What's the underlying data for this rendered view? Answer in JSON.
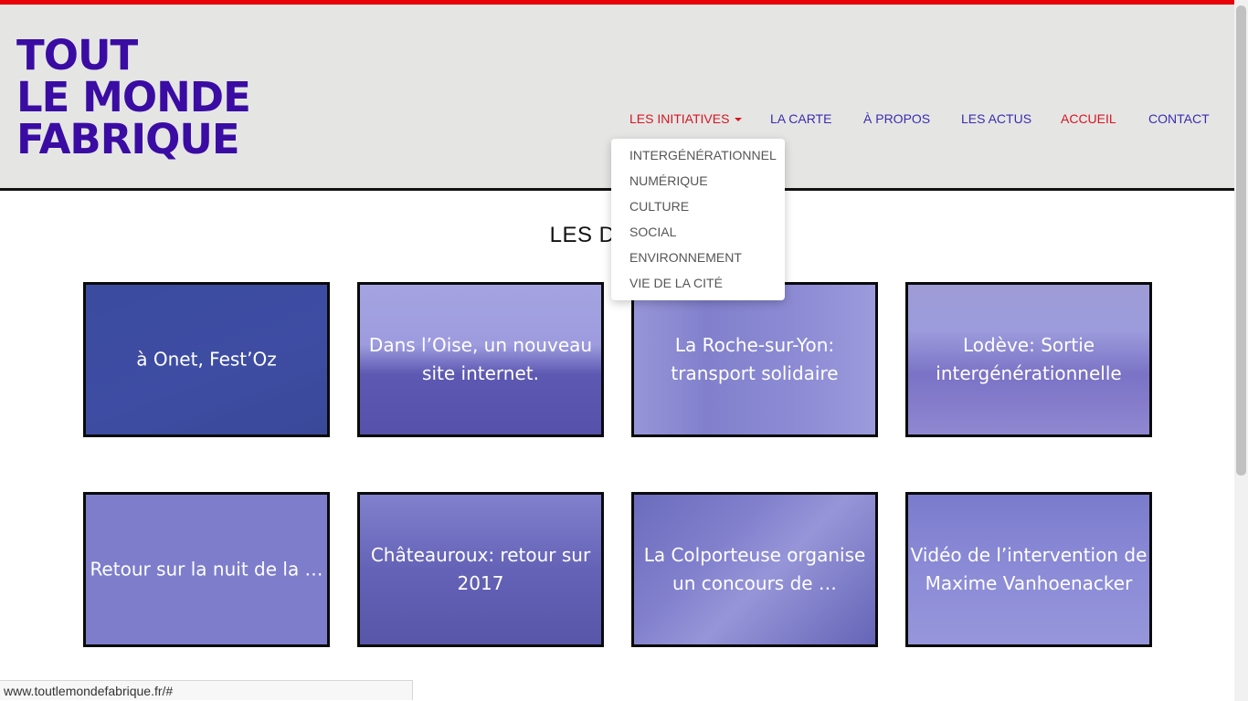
{
  "logo": {
    "line1": "TOUT",
    "line2": "LE MONDE",
    "line3": "FABRIQUE"
  },
  "nav": {
    "items": [
      {
        "label": "LES INITIATIVES"
      },
      {
        "label": "LA CARTE"
      },
      {
        "label": "À PROPOS"
      },
      {
        "label": "LES ACTUS"
      },
      {
        "label": "ACCUEIL"
      },
      {
        "label": "CONTACT"
      }
    ]
  },
  "dropdown": {
    "items": [
      "INTERGÉNÉRATIONNEL",
      "NUMÉRIQUE",
      "CULTURE",
      "SOCIAL",
      "ENVIRONNEMENT",
      "VIE DE LA CITÉ"
    ]
  },
  "section": {
    "title": "LES DERNIÈ"
  },
  "cards": [
    {
      "title": "à Onet, Fest’Oz"
    },
    {
      "title": "Dans l’Oise, un nouveau site internet."
    },
    {
      "title": "La Roche-sur-Yon: transport solidaire"
    },
    {
      "title": "Lodève: Sortie intergénérationnelle"
    },
    {
      "title": "Retour sur la nuit de la …"
    },
    {
      "title": "Châteauroux: retour sur 2017"
    },
    {
      "title": "La Colporteuse organise un concours de …"
    },
    {
      "title": "Vidéo de l’intervention de Maxime Vanhoenacker"
    }
  ],
  "status": {
    "url": "www.toutlemondefabrique.fr/#"
  },
  "colors": {
    "brand": "#3a0ca3",
    "accent": "#e8000b",
    "nav": "#3a2bb0",
    "overlay": "#7c7ccc"
  }
}
